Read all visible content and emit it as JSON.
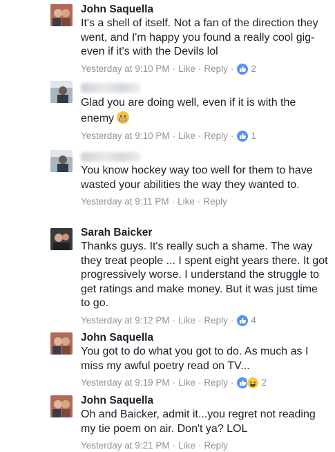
{
  "comments": [
    {
      "author": "John Saquella",
      "text": "It's a shell of itself. Not a fan of the direction they went, and I'm happy you found a really cool gig-even if it's with the Devils lol",
      "time": "Yesterday at 9:10 PM",
      "like": "Like",
      "reply": "Reply",
      "reactions": [
        "like"
      ],
      "reaction_count": "2"
    },
    {
      "author": "",
      "text": "Glad you are doing well, even if it is with the enemy",
      "emoji": "grimacing",
      "time": "Yesterday at 9:10 PM",
      "like": "Like",
      "reply": "Reply",
      "reactions": [
        "like"
      ],
      "reaction_count": "1"
    },
    {
      "author": "",
      "text": "You know hockey way too well for them to have wasted your abilities the way they wanted to.",
      "time": "Yesterday at 9:11 PM",
      "like": "Like",
      "reply": "Reply"
    },
    {
      "author": "Sarah Baicker",
      "text": "Thanks guys. It's really such a shame. The way they treat people ... I spent eight years there. It got progressively worse. I understand the struggle to get ratings and make money. But it was just time to go.",
      "time": "Yesterday at 9:12 PM",
      "like": "Like",
      "reply": "Reply",
      "reactions": [
        "like"
      ],
      "reaction_count": "4"
    },
    {
      "author": "John Saquella",
      "text": "You got to do what you got to do. As much as I miss my awful poetry read on TV...",
      "time": "Yesterday at 9:19 PM",
      "like": "Like",
      "reply": "Reply",
      "reactions": [
        "like",
        "haha"
      ],
      "reaction_count": "2"
    },
    {
      "author": "John Saquella",
      "text": "Oh and Baicker, admit it...you regret not reading my tie poem on air. Don't ya? LOL",
      "time": "Yesterday at 9:21 PM",
      "like": "Like",
      "reply": "Reply"
    }
  ],
  "colors": {
    "author": "#1d2129",
    "meta": "#90949c",
    "like_reaction": "#5890ff",
    "haha_reaction": "#f7c945"
  }
}
